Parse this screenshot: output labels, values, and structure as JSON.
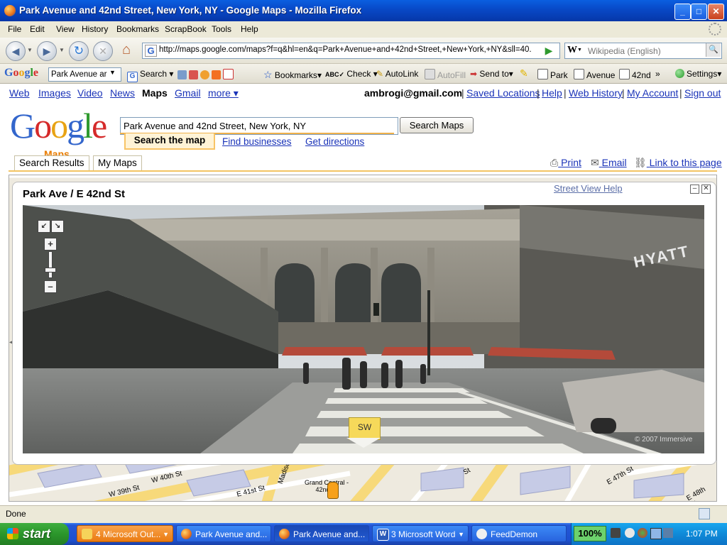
{
  "window": {
    "title": "Park Avenue and 42nd Street, New York, NY - Google Maps - Mozilla Firefox"
  },
  "menubar": [
    "File",
    "Edit",
    "View",
    "History",
    "Bookmarks",
    "ScrapBook",
    "Tools",
    "Help"
  ],
  "navbar": {
    "url": "http://maps.google.com/maps?f=q&hl=en&q=Park+Avenue+and+42nd+Street,+New+York,+NY&sll=40.",
    "search_placeholder": "Wikipedia (English)",
    "search_engine_letter": "W"
  },
  "google_toolbar": {
    "logo": "Google",
    "search_value": "Park Avenue ar",
    "search_label": "Search",
    "bookmarks_label": "Bookmarks",
    "check_label": "Check",
    "autolink_label": "AutoLink",
    "autofill_label": "AutoFill",
    "sendto_label": "Send to",
    "terms": [
      "Park",
      "Avenue",
      "42nd"
    ],
    "overflow": "»",
    "settings_label": "Settings"
  },
  "top_nav": {
    "links": [
      "Web",
      "Images",
      "Video",
      "News",
      "Maps",
      "Gmail",
      "more ▾"
    ],
    "active": "Maps",
    "user_email": "ambrogi@gmail.com",
    "user_links": [
      "Saved Locations",
      "Help",
      "Web History",
      "My Account",
      "Sign out"
    ]
  },
  "maps_header": {
    "logo_text": "Google",
    "logo_sub": "Maps",
    "search_value": "Park Avenue and 42nd Street, New York, NY",
    "search_button": "Search Maps",
    "tabs": [
      "Search the map",
      "Find businesses",
      "Get directions"
    ]
  },
  "page_tabs": [
    "Search Results",
    "My Maps"
  ],
  "page_tools": [
    "Print",
    "Email",
    "Link to this page"
  ],
  "street_view": {
    "title": "Park Ave / E 42nd St",
    "help_link": "Street View Help",
    "direction_label": "SW",
    "copyright": "© 2007 Immersive",
    "sign_text": "HYATT"
  },
  "map_labels": [
    "W 40th St",
    "W 39th St",
    "E 41st St",
    "Madison Av",
    "Grand Central - 42nd St",
    "E 47th St",
    "E 48th St",
    "St"
  ],
  "status": {
    "text": "Done"
  },
  "taskbar": {
    "start_label": "start",
    "tasks": [
      "4 Microsoft Out...",
      "Park Avenue and...",
      "Park Avenue and...",
      "3 Microsoft Word",
      "FeedDemon"
    ],
    "zoom_pct": "100%",
    "clock": "1:07 PM"
  },
  "colors": {
    "xp_blue": "#0848c6",
    "link_blue": "#1a33b8",
    "maps_orange": "#e87b00",
    "start_green": "#2b962b"
  }
}
